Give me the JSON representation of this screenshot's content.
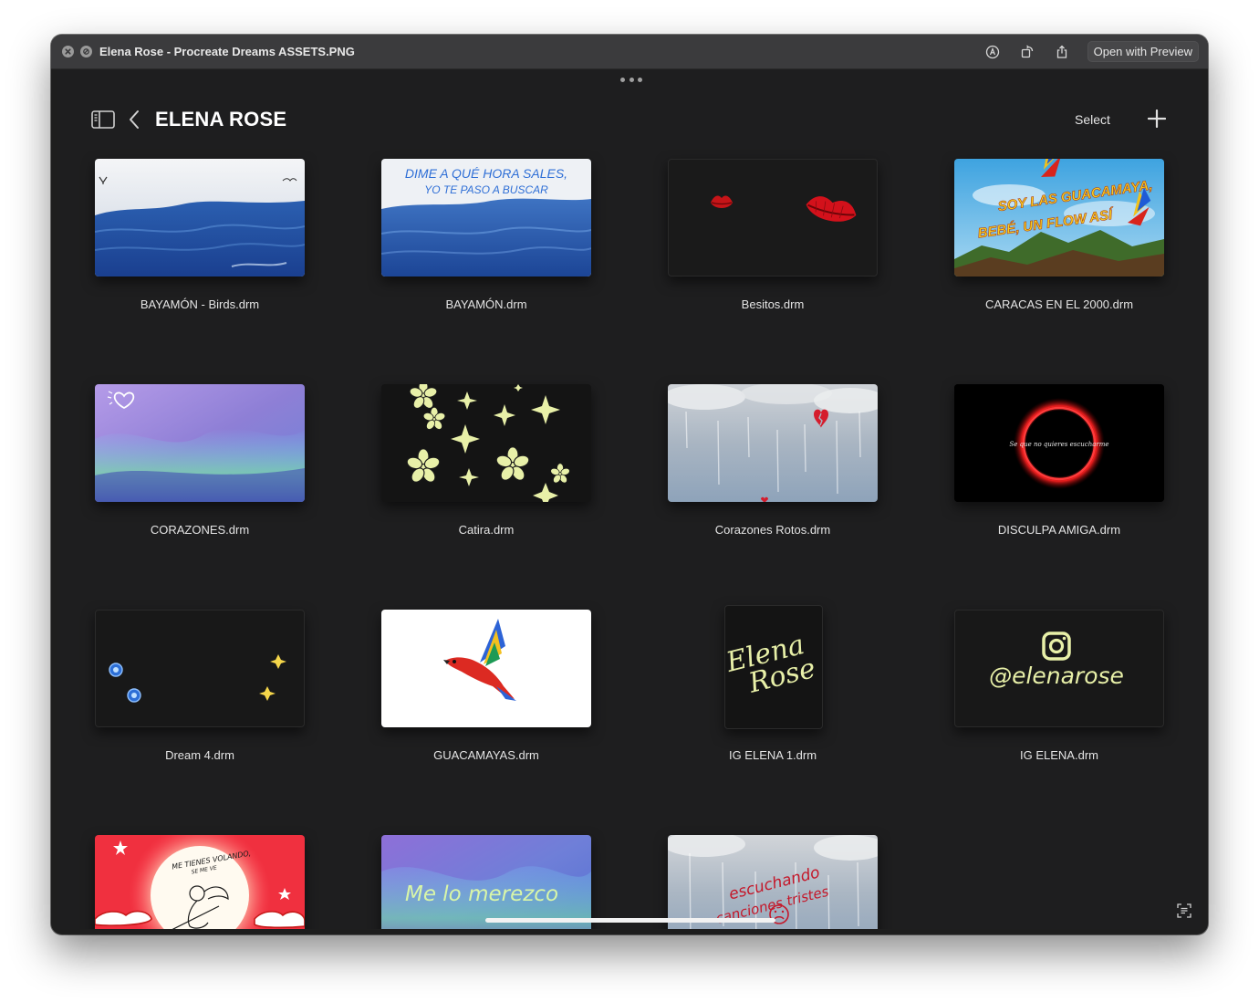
{
  "window": {
    "title": "Elena Rose - Procreate Dreams ASSETS.PNG",
    "open_with": "Open with Preview",
    "toolbar_icons": [
      "markup-icon",
      "rotate-icon",
      "share-icon"
    ]
  },
  "header": {
    "title": "ELENA ROSE",
    "select_label": "Select",
    "icons": [
      "sidebar-icon",
      "chevron-left-icon",
      "plus-icon"
    ]
  },
  "files": [
    {
      "name": "BAYAMÓN - Birds.drm"
    },
    {
      "name": "BAYAMÓN.drm",
      "art_text": [
        "DIME A QUÉ HORA SALES,",
        "YO TE PASO A BUSCAR"
      ]
    },
    {
      "name": "Besitos.drm"
    },
    {
      "name": "CARACAS EN EL 2000.drm",
      "art_text": [
        "SOY LAS GUACAMAYA,",
        "BEBÉ, UN FLOW ASÍ"
      ]
    },
    {
      "name": "CORAZONES.drm"
    },
    {
      "name": "Catira.drm"
    },
    {
      "name": "Corazones Rotos.drm"
    },
    {
      "name": "DISCULPA AMIGA.drm",
      "art_text": [
        "Se que no quieres escucharme"
      ]
    },
    {
      "name": "Dream 4.drm"
    },
    {
      "name": "GUACAMAYAS.drm"
    },
    {
      "name": "IG ELENA 1.drm",
      "art_text": [
        "Elena",
        "Rose"
      ]
    },
    {
      "name": "IG ELENA.drm",
      "art_text": [
        "@elenarose"
      ]
    },
    {
      "name": "",
      "art_text": [
        "ME TIENES VOLANDO,",
        "SE ME VE"
      ]
    },
    {
      "name": "",
      "art_text": [
        "Me lo merezco"
      ]
    },
    {
      "name": "",
      "art_text": [
        "escuchando",
        "canciones tristes"
      ]
    }
  ],
  "colors": {
    "background": "#1e1e1f",
    "titlebar": "#3b3b3d",
    "art_accent_green": "#e8f0a8",
    "art_accent_red": "#d3111b"
  }
}
